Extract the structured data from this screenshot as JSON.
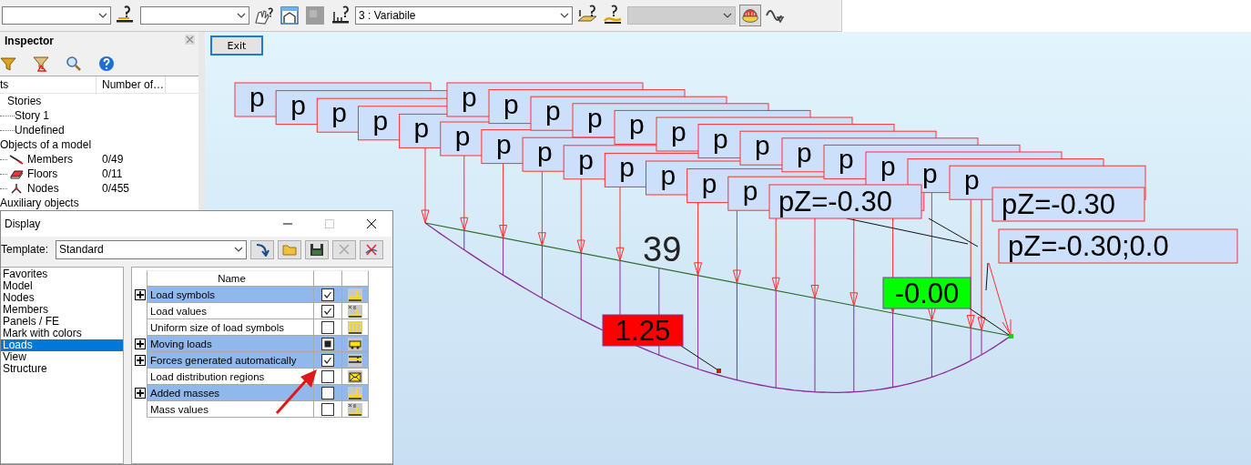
{
  "toolbar": {
    "variant_selector": {
      "value": "3 : Variabile"
    },
    "disabled_selector": {
      "disabled": true
    },
    "load_display_toggle": {
      "on": true
    }
  },
  "inspector": {
    "title": "Inspector",
    "columns": [
      "ts",
      "Number of…"
    ],
    "tree": [
      {
        "label": "Stories",
        "children": [
          {
            "label": "Story 1"
          },
          {
            "label": "Undefined"
          }
        ]
      },
      {
        "label": "Objects of a model",
        "children": [
          {
            "label": "Members",
            "count": "0/49"
          },
          {
            "label": "Floors",
            "count": "0/11"
          },
          {
            "label": "Nodes",
            "count": "0/455"
          }
        ]
      },
      {
        "label": "Auxiliary objects"
      }
    ]
  },
  "canvas": {
    "exit_button": "Exit",
    "stacked_labels": [
      {
        "text": "p"
      },
      {
        "text": "p"
      },
      {
        "text": "p"
      },
      {
        "text": "p"
      },
      {
        "text": "p"
      },
      {
        "text": "p"
      },
      {
        "text": "p"
      },
      {
        "text": "p"
      },
      {
        "text": "p"
      },
      {
        "text": "p"
      },
      {
        "text": "p"
      },
      {
        "text": "p"
      },
      {
        "text": "p"
      },
      {
        "text": "p"
      },
      {
        "text": "p"
      },
      {
        "text": "p"
      },
      {
        "text": "p"
      },
      {
        "text": "p"
      },
      {
        "text": "p"
      },
      {
        "text": "p"
      },
      {
        "text": "p"
      },
      {
        "text": "p"
      },
      {
        "text": "p"
      },
      {
        "text": "p"
      },
      {
        "text": "p"
      },
      {
        "text": "p"
      }
    ],
    "front_labels": [
      "pZ=-0.30",
      "pZ=-0.30",
      "pZ=-0.30;0.0"
    ],
    "member_number": "39",
    "value_labels": [
      {
        "text": "1.25",
        "color": "#ff0000"
      },
      {
        "text": "-0.00",
        "color": "#00ff00"
      }
    ]
  },
  "display": {
    "title": "Display",
    "template": {
      "label": "Template:",
      "value": "Standard"
    },
    "categories": [
      {
        "label": "Favorites",
        "selected": false
      },
      {
        "label": "Model",
        "selected": false
      },
      {
        "label": "Nodes",
        "selected": false
      },
      {
        "label": "Members",
        "selected": false
      },
      {
        "label": "Panels / FE",
        "selected": false
      },
      {
        "label": "Mark with colors",
        "selected": false
      },
      {
        "label": "Loads",
        "selected": true
      },
      {
        "label": "View",
        "selected": false
      },
      {
        "label": "Structure",
        "selected": false
      }
    ],
    "grid": {
      "columns": [
        "Name"
      ],
      "rows": [
        {
          "label": "Load symbols",
          "expandable": true,
          "checked": true,
          "indeterminate": false
        },
        {
          "label": "Load values",
          "expandable": false,
          "checked": true,
          "indeterminate": false
        },
        {
          "label": "Uniform size of load symbols",
          "expandable": false,
          "checked": false,
          "indeterminate": false
        },
        {
          "label": "Moving loads",
          "expandable": true,
          "indeterminate": true
        },
        {
          "label": "Forces generated automatically",
          "expandable": true,
          "checked": true,
          "indeterminate": false
        },
        {
          "label": "Load distribution regions",
          "expandable": false,
          "checked": false,
          "indeterminate": false
        },
        {
          "label": "Added masses",
          "expandable": true,
          "checked": false,
          "indeterminate": false
        },
        {
          "label": "Mass values",
          "expandable": false,
          "checked": false,
          "indeterminate": false
        }
      ]
    }
  }
}
